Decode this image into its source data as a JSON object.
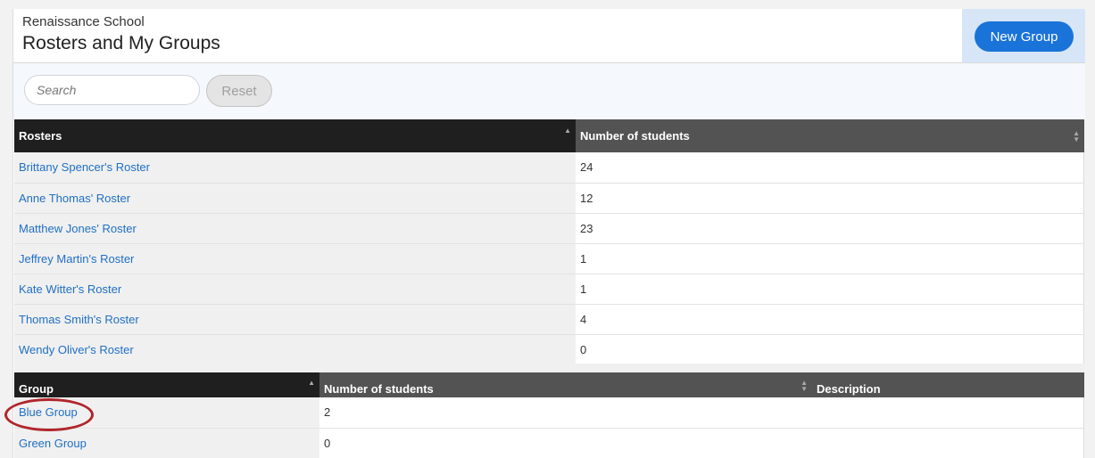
{
  "header": {
    "school_name": "Renaissance School",
    "title": "Rosters and My Groups",
    "new_group_label": "New Group"
  },
  "toolbar": {
    "search_placeholder": "Search",
    "search_value": "",
    "reset_label": "Reset"
  },
  "rosters": {
    "columns": [
      "Rosters",
      "Number of students"
    ],
    "rows": [
      {
        "name": "Brittany Spencer's Roster",
        "count": "24"
      },
      {
        "name": "Anne Thomas' Roster",
        "count": "12"
      },
      {
        "name": "Matthew Jones' Roster",
        "count": "23"
      },
      {
        "name": "Jeffrey Martin's Roster",
        "count": "1"
      },
      {
        "name": "Kate Witter's Roster",
        "count": "1"
      },
      {
        "name": "Thomas Smith's Roster",
        "count": "4"
      },
      {
        "name": "Wendy Oliver's Roster",
        "count": "0"
      }
    ]
  },
  "groups": {
    "columns": [
      "Group",
      "Number of students",
      "Description"
    ],
    "rows": [
      {
        "name": "Blue Group",
        "count": "2",
        "description": ""
      },
      {
        "name": "Green Group",
        "count": "0",
        "description": ""
      }
    ]
  },
  "colors": {
    "primary": "#1a73d9",
    "link": "#1f6fc5",
    "header_dark": "#1f1f1f",
    "header_mid": "#535353",
    "highlight": "#b0262b"
  }
}
